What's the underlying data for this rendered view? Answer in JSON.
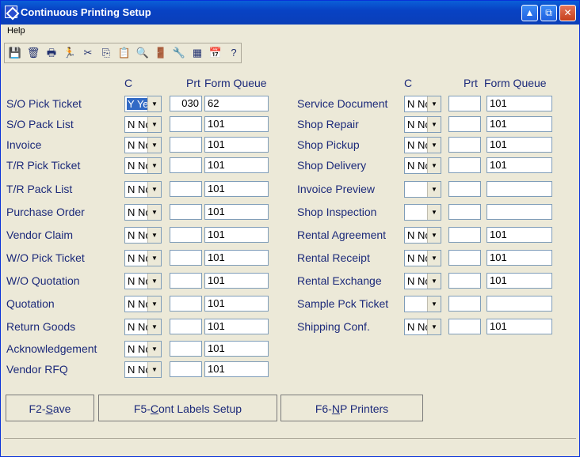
{
  "window": {
    "title": "Continuous Printing Setup"
  },
  "menu": {
    "help": "Help"
  },
  "toolbar": {
    "icons": [
      "save-icon",
      "trash-icon",
      "print-icon",
      "run-icon",
      "cut-icon",
      "copy-icon",
      "paste-icon",
      "find-icon",
      "exit-door-icon",
      "tools-icon",
      "calculator-icon",
      "calendar-icon",
      "help-icon"
    ]
  },
  "headers": {
    "c": "C",
    "prt": "Prt",
    "form_queue": "Form Queue"
  },
  "left_rows": [
    {
      "label": "S/O Pick Ticket",
      "c": "Y Yes",
      "prt": "030",
      "queue": "62",
      "selected": true
    },
    {
      "label": "S/O Pack List",
      "c": "N No",
      "prt": "",
      "queue": "101"
    },
    {
      "label": "Invoice",
      "c": "N No",
      "prt": "",
      "queue": "101"
    },
    {
      "label": "T/R Pick Ticket",
      "c": "N No",
      "prt": "",
      "queue": "101"
    },
    {
      "label": "T/R Pack List",
      "c": "N No",
      "prt": "",
      "queue": "101"
    },
    {
      "label": "Purchase Order",
      "c": "N No",
      "prt": "",
      "queue": "101"
    },
    {
      "label": "Vendor Claim",
      "c": "N No",
      "prt": "",
      "queue": "101"
    },
    {
      "label": "W/O Pick Ticket",
      "c": "N No",
      "prt": "",
      "queue": "101"
    },
    {
      "label": "W/O Quotation",
      "c": "N No",
      "prt": "",
      "queue": "101"
    },
    {
      "label": "Quotation",
      "c": "N No",
      "prt": "",
      "queue": "101"
    },
    {
      "label": "Return Goods",
      "c": "N No",
      "prt": "",
      "queue": "101"
    },
    {
      "label": "Acknowledgement",
      "c": "N No",
      "prt": "",
      "queue": "101"
    },
    {
      "label": "Vendor RFQ",
      "c": "N No",
      "prt": "",
      "queue": "101"
    }
  ],
  "right_rows": [
    {
      "label": "Service Document",
      "c": "N No",
      "prt": "",
      "queue": "101"
    },
    {
      "label": "Shop Repair",
      "c": "N No",
      "prt": "",
      "queue": "101"
    },
    {
      "label": "Shop Pickup",
      "c": "N No",
      "prt": "",
      "queue": "101"
    },
    {
      "label": "Shop Delivery",
      "c": "N No",
      "prt": "",
      "queue": "101"
    },
    {
      "label": "Invoice Preview",
      "c": "",
      "prt": "",
      "queue": ""
    },
    {
      "label": "Shop Inspection",
      "c": "",
      "prt": "",
      "queue": ""
    },
    {
      "label": "Rental Agreement",
      "c": "N No",
      "prt": "",
      "queue": "101"
    },
    {
      "label": "Rental Receipt",
      "c": "N No",
      "prt": "",
      "queue": "101"
    },
    {
      "label": "Rental Exchange",
      "c": "N No",
      "prt": "",
      "queue": "101"
    },
    {
      "label": "Sample Pck Ticket",
      "c": "",
      "prt": "",
      "queue": ""
    },
    {
      "label": "Shipping Conf.",
      "c": "N No",
      "prt": "",
      "queue": "101"
    }
  ],
  "buttons": {
    "f2": {
      "prefix": "F2-",
      "key": "S",
      "rest": "ave"
    },
    "f5": {
      "prefix": "F5-",
      "key": "C",
      "rest": "ont Labels Setup"
    },
    "f6": {
      "prefix": "F6-",
      "key": "N",
      "rest": "P Printers"
    }
  }
}
